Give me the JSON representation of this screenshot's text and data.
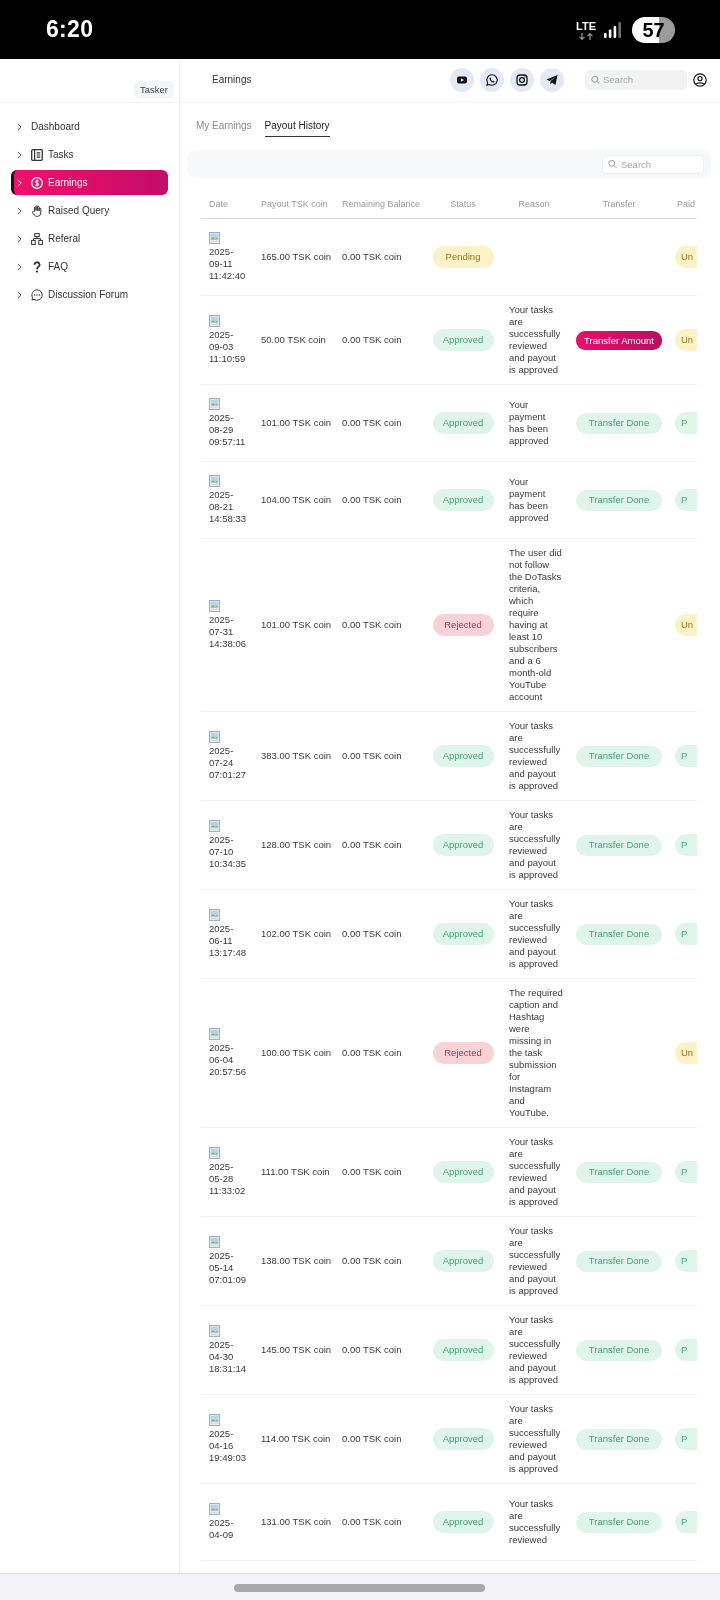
{
  "status_bar": {
    "time": "6:20",
    "network": "LTE",
    "battery": "57"
  },
  "sidebar": {
    "brand": "Tasker",
    "items": [
      {
        "label": "Dashboard",
        "selected": false
      },
      {
        "label": "Tasks",
        "selected": false
      },
      {
        "label": "Earnings",
        "selected": true
      },
      {
        "label": "Raised Query",
        "selected": false
      },
      {
        "label": "Referal",
        "selected": false
      },
      {
        "label": "FAQ",
        "selected": false
      },
      {
        "label": "Discussion Forum",
        "selected": false
      }
    ]
  },
  "header": {
    "title": "Earnings",
    "search": {
      "placeholder": "Search"
    }
  },
  "tabs": [
    {
      "label": "My Earnings",
      "selected": false
    },
    {
      "label": "Payout History",
      "selected": true
    }
  ],
  "table": {
    "search": {
      "placeholder": "Search"
    },
    "columns": [
      "Date",
      "Payout TSK coin",
      "Remaining Balance",
      "Status",
      "Reason",
      "Transfer",
      "Paid"
    ],
    "rows": [
      {
        "date": "2025-09-11 11:42:40",
        "payout": "165.00 TSK coin",
        "balance": "0.00 TSK coin",
        "status": {
          "label": "Pending",
          "kind": "pending"
        },
        "paid": {
          "label": "Un",
          "kind": "unpaid"
        }
      },
      {
        "date": "2025-09-03 11:10:59",
        "payout": "50.00 TSK coin",
        "balance": "0.00 TSK coin",
        "status": {
          "label": "Approved",
          "kind": "approved"
        },
        "reason": "Your tasks are successfully reviewed and payout is approved",
        "transfer": {
          "label": "Transfer Amount",
          "kind": "action"
        },
        "paid": {
          "label": "Un",
          "kind": "unpaid"
        }
      },
      {
        "date": "2025-08-29 09:57:11",
        "payout": "101.00 TSK coin",
        "balance": "0.00 TSK coin",
        "status": {
          "label": "Approved",
          "kind": "approved"
        },
        "reason": "Your payment has been approved",
        "transfer": {
          "label": "Transfer Done",
          "kind": "done"
        },
        "paid": {
          "label": "P",
          "kind": "paid"
        }
      },
      {
        "date": "2025-08-21 14:58:33",
        "payout": "104.00 TSK coin",
        "balance": "0.00 TSK coin",
        "status": {
          "label": "Approved",
          "kind": "approved"
        },
        "reason": "Your payment has been approved",
        "transfer": {
          "label": "Transfer Done",
          "kind": "done"
        },
        "paid": {
          "label": "P",
          "kind": "paid"
        }
      },
      {
        "date": "2025-07-31 14:38:06",
        "payout": "101.00 TSK coin",
        "balance": "0.00 TSK coin",
        "status": {
          "label": "Rejected",
          "kind": "rejected"
        },
        "reason": "The user did not follow the DoTasks criteria, which require having at least 10 subscribers and a 6 month-old YouTube account",
        "paid": {
          "label": "Un",
          "kind": "unpaid"
        }
      },
      {
        "date": "2025-07-24 07:01:27",
        "payout": "383.00 TSK coin",
        "balance": "0.00 TSK coin",
        "status": {
          "label": "Approved",
          "kind": "approved"
        },
        "reason": "Your tasks are successfully reviewed and payout is approved",
        "transfer": {
          "label": "Transfer Done",
          "kind": "done"
        },
        "paid": {
          "label": "P",
          "kind": "paid"
        }
      },
      {
        "date": "2025-07-10 10:34:35",
        "payout": "128.00 TSK coin",
        "balance": "0.00 TSK coin",
        "status": {
          "label": "Approved",
          "kind": "approved"
        },
        "reason": "Your tasks are successfully reviewed and payout is approved",
        "transfer": {
          "label": "Transfer Done",
          "kind": "done"
        },
        "paid": {
          "label": "P",
          "kind": "paid"
        }
      },
      {
        "date": "2025-06-11 13:17:48",
        "payout": "102.00 TSK coin",
        "balance": "0.00 TSK coin",
        "status": {
          "label": "Approved",
          "kind": "approved"
        },
        "reason": "Your tasks are successfully reviewed and payout is approved",
        "transfer": {
          "label": "Transfer Done",
          "kind": "done"
        },
        "paid": {
          "label": "P",
          "kind": "paid"
        }
      },
      {
        "date": "2025-06-04 20:57:56",
        "payout": "100.00 TSK coin",
        "balance": "0.00 TSK coin",
        "status": {
          "label": "Rejected",
          "kind": "rejected"
        },
        "reason": "The required caption and Hashtag were missing in the task submission for Instagram and YouTube.",
        "paid": {
          "label": "Un",
          "kind": "unpaid"
        }
      },
      {
        "date": "2025-05-28 11:33:02",
        "payout": "111.00 TSK coin",
        "balance": "0.00 TSK coin",
        "status": {
          "label": "Approved",
          "kind": "approved"
        },
        "reason": "Your tasks are successfully reviewed and payout is approved",
        "transfer": {
          "label": "Transfer Done",
          "kind": "done"
        },
        "paid": {
          "label": "P",
          "kind": "paid"
        }
      },
      {
        "date": "2025-05-14 07:01:09",
        "payout": "138.00 TSK coin",
        "balance": "0.00 TSK coin",
        "status": {
          "label": "Approved",
          "kind": "approved"
        },
        "reason": "Your tasks are successfully reviewed and payout is approved",
        "transfer": {
          "label": "Transfer Done",
          "kind": "done"
        },
        "paid": {
          "label": "P",
          "kind": "paid"
        }
      },
      {
        "date": "2025-04-30 18:31:14",
        "payout": "145.00 TSK coin",
        "balance": "0.00 TSK coin",
        "status": {
          "label": "Approved",
          "kind": "approved"
        },
        "reason": "Your tasks are successfully reviewed and payout is approved",
        "transfer": {
          "label": "Transfer Done",
          "kind": "done"
        },
        "paid": {
          "label": "P",
          "kind": "paid"
        }
      },
      {
        "date": "2025-04-16 19:49:03",
        "payout": "114.00 TSK coin",
        "balance": "0.00 TSK coin",
        "status": {
          "label": "Approved",
          "kind": "approved"
        },
        "reason": "Your tasks are successfully reviewed and payout is approved",
        "transfer": {
          "label": "Transfer Done",
          "kind": "done"
        },
        "paid": {
          "label": "P",
          "kind": "paid"
        }
      },
      {
        "date": "2025-04-09",
        "payout": "131.00 TSK coin",
        "balance": "0.00 TSK coin",
        "status": {
          "label": "Approved",
          "kind": "approved"
        },
        "reason": "Your tasks are successfully reviewed",
        "transfer": {
          "label": "Transfer Done",
          "kind": "done"
        },
        "paid": {
          "label": "P",
          "kind": "paid"
        }
      }
    ]
  }
}
